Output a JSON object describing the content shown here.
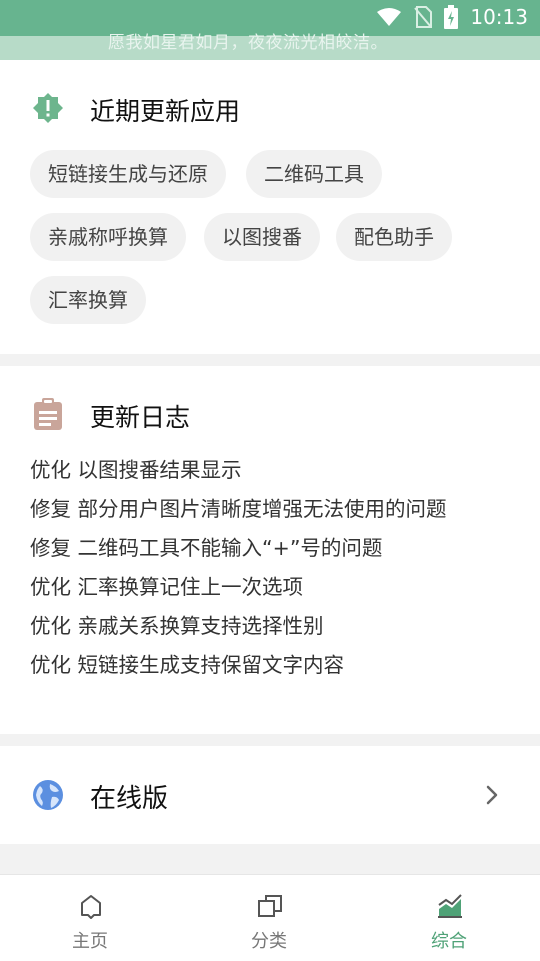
{
  "status_bar": {
    "time": "10:13"
  },
  "header": {
    "quote": "愿我如星君如月，夜夜流光相皎洁。"
  },
  "recent_apps": {
    "title": "近期更新应用",
    "items": [
      "短链接生成与还原",
      "二维码工具",
      "亲戚称呼换算",
      "以图搜番",
      "配色助手",
      "汇率换算"
    ]
  },
  "changelog": {
    "title": "更新日志",
    "lines": [
      "优化 以图搜番结果显示",
      "修复 部分用户图片清晰度增强无法使用的问题",
      "修复 二维码工具不能输入“+”号的问题",
      "优化 汇率换算记住上一次选项",
      "优化 亲戚关系换算支持选择性别",
      "优化 短链接生成支持保留文字内容"
    ]
  },
  "online": {
    "label": "在线版"
  },
  "bottom_nav": {
    "home": "主页",
    "category": "分类",
    "general": "综合"
  },
  "colors": {
    "accent": "#4fa277",
    "header": "#67b48f",
    "recent_icon": "#6db58d",
    "changelog_icon": "#c9a59a",
    "globe_icon": "#5b8fe0"
  }
}
